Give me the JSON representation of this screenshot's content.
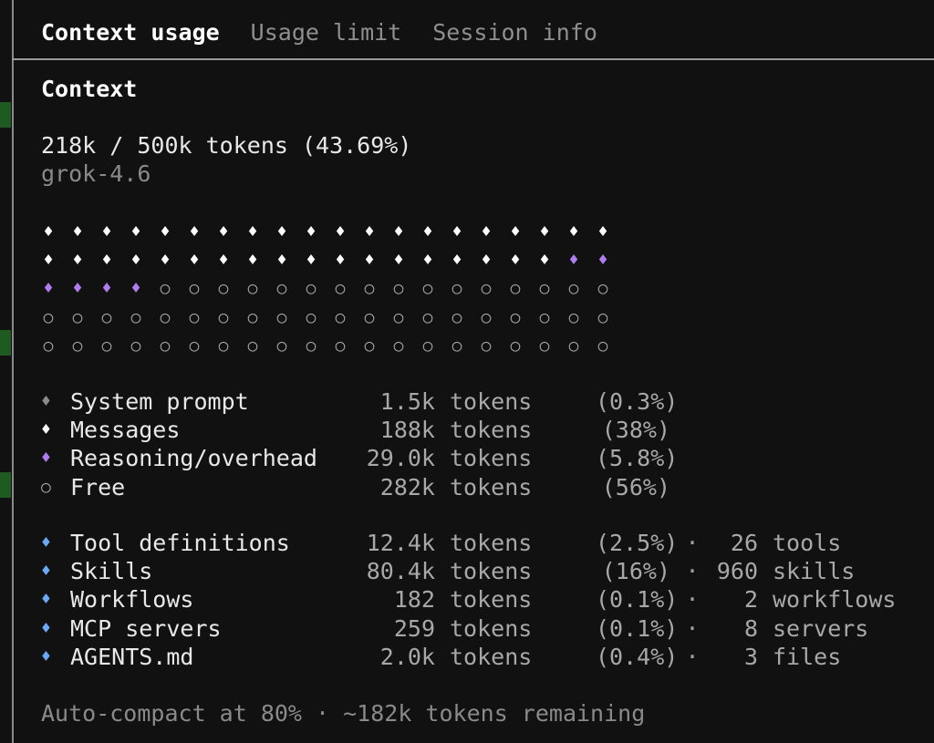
{
  "tabs": [
    {
      "label": "Context usage",
      "active": true
    },
    {
      "label": "Usage limit",
      "active": false
    },
    {
      "label": "Session info",
      "active": false
    }
  ],
  "context": {
    "heading": "Context",
    "usage_line": "218k / 500k tokens (43.69%)",
    "model": "grok-4.6"
  },
  "usage_grid": {
    "columns": 20,
    "rows": 5,
    "cells_by_category": {
      "messages": 38,
      "reasoning": 6,
      "free": 56
    },
    "symbols": {
      "used": "♦",
      "free": "○"
    }
  },
  "breakdown": [
    {
      "icon": "♦",
      "icon_name": "system-prompt-diamond-icon",
      "color": "#8c8c8c",
      "label": "System prompt",
      "amount": "1.5k",
      "unit": "tokens",
      "pct": "(0.3%)"
    },
    {
      "icon": "♦",
      "icon_name": "messages-diamond-icon",
      "color": "#ffffff",
      "label": "Messages",
      "amount": "188k",
      "unit": "tokens",
      "pct": "(38%)"
    },
    {
      "icon": "♦",
      "icon_name": "reasoning-diamond-icon",
      "color": "#b07cf0",
      "label": "Reasoning/overhead",
      "amount": "29.0k",
      "unit": "tokens",
      "pct": "(5.8%)"
    },
    {
      "icon": "○",
      "icon_name": "free-circle-icon",
      "color": "#a8a8a8",
      "label": "Free",
      "amount": "282k",
      "unit": "tokens",
      "pct": "(56%)"
    }
  ],
  "details": [
    {
      "icon": "♦",
      "icon_name": "tool-definitions-diamond-icon",
      "color": "#6aa9f5",
      "label": "Tool definitions",
      "amount": "12.4k",
      "unit": "tokens",
      "pct": "(2.5%)",
      "sep": "·",
      "count": "26",
      "count_unit": "tools"
    },
    {
      "icon": "♦",
      "icon_name": "skills-diamond-icon",
      "color": "#6aa9f5",
      "label": "Skills",
      "amount": "80.4k",
      "unit": "tokens",
      "pct": "(16%)",
      "sep": "·",
      "count": "960",
      "count_unit": "skills"
    },
    {
      "icon": "♦",
      "icon_name": "workflows-diamond-icon",
      "color": "#6aa9f5",
      "label": "Workflows",
      "amount": "182",
      "unit": "tokens",
      "pct": "(0.1%)",
      "sep": "·",
      "count": "2",
      "count_unit": "workflows"
    },
    {
      "icon": "♦",
      "icon_name": "mcp-servers-diamond-icon",
      "color": "#6aa9f5",
      "label": "MCP servers",
      "amount": "259",
      "unit": "tokens",
      "pct": "(0.1%)",
      "sep": "·",
      "count": "8",
      "count_unit": "servers"
    },
    {
      "icon": "♦",
      "icon_name": "agents-md-diamond-icon",
      "color": "#6aa9f5",
      "label": "AGENTS.md",
      "amount": "2.0k",
      "unit": "tokens",
      "pct": "(0.4%)",
      "sep": "·",
      "count": "3",
      "count_unit": "files"
    }
  ],
  "footer": "Auto-compact at 80% · ~182k tokens remaining",
  "colors": {
    "background": "#111111",
    "messages": "#ffffff",
    "reasoning": "#b07cf0",
    "details": "#6aa9f5",
    "muted": "#8a8a8a"
  }
}
